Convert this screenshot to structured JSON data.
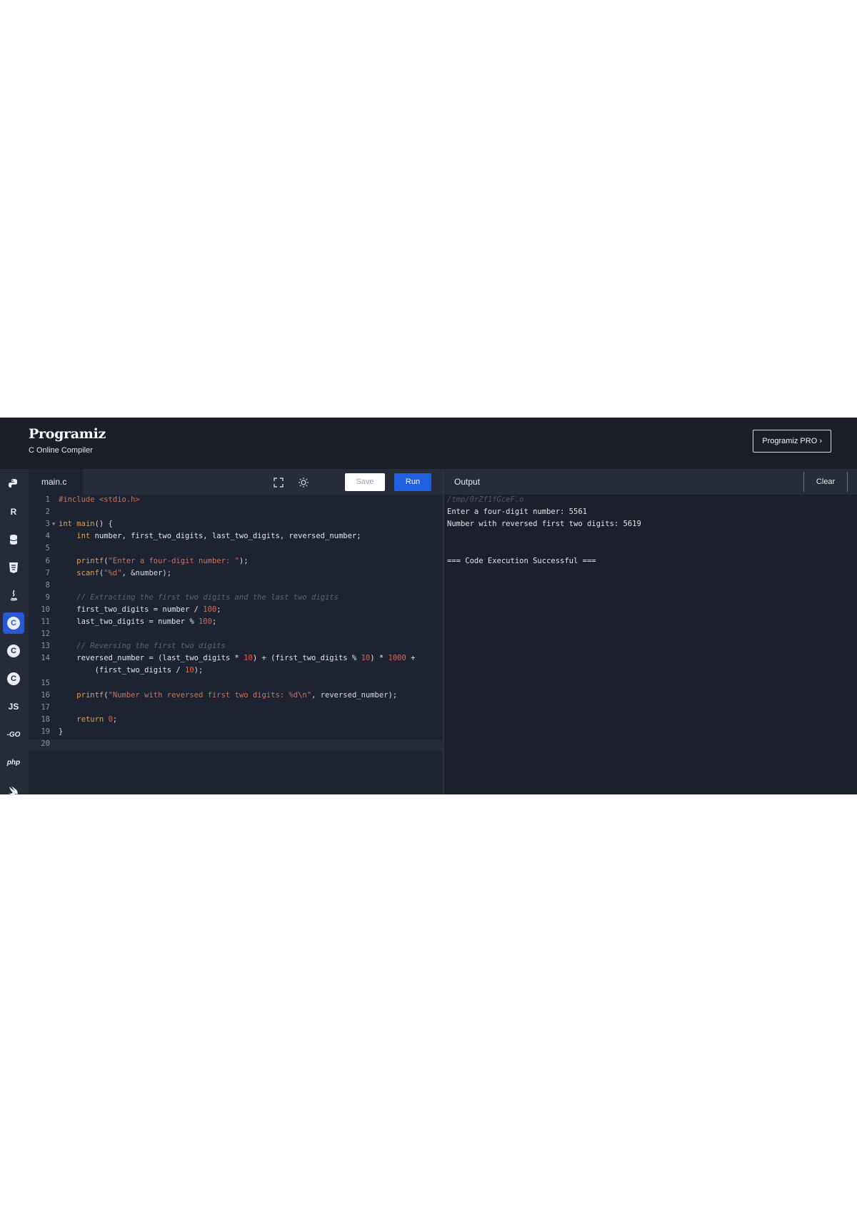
{
  "header": {
    "logo": "Programiz",
    "subtitle": "C Online Compiler",
    "pro_button": "Programiz PRO ›"
  },
  "sidebar": {
    "items": [
      {
        "icon": "python-icon",
        "label": ""
      },
      {
        "icon": "r-icon",
        "label": "R"
      },
      {
        "icon": "sql-icon",
        "label": ""
      },
      {
        "icon": "html-icon",
        "label": ""
      },
      {
        "icon": "java-icon",
        "label": ""
      },
      {
        "icon": "c-icon",
        "label": "C",
        "active": true
      },
      {
        "icon": "cpp-icon",
        "label": "C"
      },
      {
        "icon": "csharp-icon",
        "label": "C"
      },
      {
        "icon": "js-icon",
        "label": "JS"
      },
      {
        "icon": "go-icon",
        "label": "-GO"
      },
      {
        "icon": "php-icon",
        "label": "php"
      },
      {
        "icon": "swift-icon",
        "label": ""
      }
    ],
    "accent": "#2857d6"
  },
  "editor": {
    "tab": "main.c",
    "save_label": "Save",
    "run_label": "Run",
    "run_color": "#1f5fe0",
    "lines": [
      {
        "num": "1",
        "fold": "",
        "tokens": [
          [
            "pre",
            "#include "
          ],
          [
            "inc",
            "<stdio.h>"
          ]
        ]
      },
      {
        "num": "2",
        "fold": "",
        "tokens": []
      },
      {
        "num": "3",
        "fold": "▾",
        "tokens": [
          [
            "kw",
            "int "
          ],
          [
            "fn",
            "main"
          ],
          [
            "op",
            "() {"
          ]
        ]
      },
      {
        "num": "4",
        "fold": "",
        "tokens": [
          [
            "id",
            "    "
          ],
          [
            "kw",
            "int "
          ],
          [
            "id",
            "number, first_two_digits, last_two_digits, reversed_number;"
          ]
        ]
      },
      {
        "num": "5",
        "fold": "",
        "tokens": []
      },
      {
        "num": "6",
        "fold": "",
        "tokens": [
          [
            "id",
            "    "
          ],
          [
            "fn",
            "printf"
          ],
          [
            "op",
            "("
          ],
          [
            "str",
            "\"Enter a four-digit number: \""
          ],
          [
            "op",
            ");"
          ]
        ]
      },
      {
        "num": "7",
        "fold": "",
        "tokens": [
          [
            "id",
            "    "
          ],
          [
            "fn",
            "scanf"
          ],
          [
            "op",
            "("
          ],
          [
            "str",
            "\"%d\""
          ],
          [
            "op",
            ", &number);"
          ]
        ]
      },
      {
        "num": "8",
        "fold": "",
        "tokens": []
      },
      {
        "num": "9",
        "fold": "",
        "tokens": [
          [
            "id",
            "    "
          ],
          [
            "cm",
            "// Extracting the first two digits and the last two digits"
          ]
        ]
      },
      {
        "num": "10",
        "fold": "",
        "tokens": [
          [
            "id",
            "    first_two_digits = number / "
          ],
          [
            "num",
            "100"
          ],
          [
            "op",
            ";"
          ]
        ]
      },
      {
        "num": "11",
        "fold": "",
        "tokens": [
          [
            "id",
            "    last_two_digits = number % "
          ],
          [
            "num",
            "100"
          ],
          [
            "op",
            ";"
          ]
        ]
      },
      {
        "num": "12",
        "fold": "",
        "tokens": []
      },
      {
        "num": "13",
        "fold": "",
        "tokens": [
          [
            "id",
            "    "
          ],
          [
            "cm",
            "// Reversing the first two digits"
          ]
        ]
      },
      {
        "num": "14",
        "fold": "",
        "tokens": [
          [
            "id",
            "    reversed_number = (last_two_digits * "
          ],
          [
            "num",
            "10"
          ],
          [
            "id",
            ") + (first_two_digits % "
          ],
          [
            "num",
            "10"
          ],
          [
            "id",
            ") * "
          ],
          [
            "num",
            "1000"
          ],
          [
            "id",
            " +"
          ]
        ]
      },
      {
        "num": "",
        "fold": "",
        "tokens": [
          [
            "id",
            "        (first_two_digits / "
          ],
          [
            "num",
            "10"
          ],
          [
            "op",
            ");"
          ]
        ]
      },
      {
        "num": "15",
        "fold": "",
        "tokens": []
      },
      {
        "num": "16",
        "fold": "",
        "tokens": [
          [
            "id",
            "    "
          ],
          [
            "fn",
            "printf"
          ],
          [
            "op",
            "("
          ],
          [
            "str",
            "\"Number with reversed first two digits: %d\\n\""
          ],
          [
            "op",
            ", reversed_number);"
          ]
        ]
      },
      {
        "num": "17",
        "fold": "",
        "tokens": []
      },
      {
        "num": "18",
        "fold": "",
        "tokens": [
          [
            "id",
            "    "
          ],
          [
            "kw",
            "return "
          ],
          [
            "num",
            "0"
          ],
          [
            "op",
            ";"
          ]
        ]
      },
      {
        "num": "19",
        "fold": "",
        "tokens": [
          [
            "op",
            "}"
          ]
        ]
      },
      {
        "num": "20",
        "fold": "",
        "tokens": [],
        "current": true
      }
    ]
  },
  "output": {
    "title": "Output",
    "clear_label": "Clear",
    "lines": [
      {
        "kind": "path",
        "text": "/tmp/0rZf1fGceF.o"
      },
      {
        "kind": "text",
        "text": "Enter a four-digit number: 5561"
      },
      {
        "kind": "text",
        "text": "Number with reversed first two digits: 5619"
      },
      {
        "kind": "text",
        "text": ""
      },
      {
        "kind": "text",
        "text": ""
      },
      {
        "kind": "text",
        "text": "=== Code Execution Successful ==="
      }
    ]
  }
}
